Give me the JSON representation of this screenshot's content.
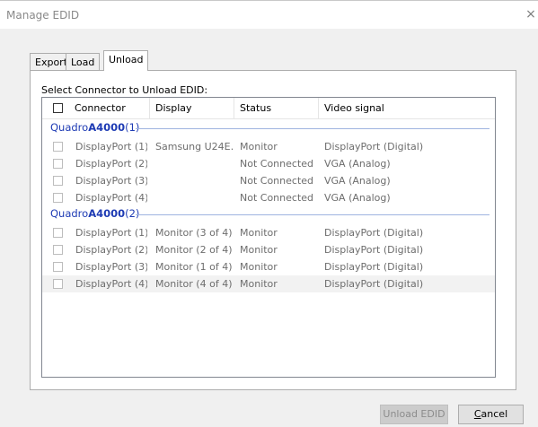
{
  "window": {
    "title": "Manage EDID",
    "close_icon": "×"
  },
  "tabs": [
    {
      "label": "Export",
      "active": false
    },
    {
      "label": "Load",
      "active": false
    },
    {
      "label": "Unload",
      "active": true
    }
  ],
  "panel": {
    "prompt": "Select Connector to Unload EDID:"
  },
  "list": {
    "columns": [
      "Connector",
      "Display",
      "Status",
      "Video signal"
    ],
    "groups": [
      {
        "name": "QuadroA4000",
        "name_prefix": "Quadro",
        "name_bold": "A4000",
        "suffix": "(1)",
        "rows": [
          {
            "connector": "DisplayPort (1)",
            "display": "Samsung U24E…",
            "status": "Monitor",
            "signal": "DisplayPort (Digital)"
          },
          {
            "connector": "DisplayPort (2)",
            "display": "",
            "status": "Not Connected",
            "signal": "VGA (Analog)"
          },
          {
            "connector": "DisplayPort (3)",
            "display": "",
            "status": "Not Connected",
            "signal": "VGA (Analog)"
          },
          {
            "connector": "DisplayPort (4)",
            "display": "",
            "status": "Not Connected",
            "signal": "VGA (Analog)"
          }
        ]
      },
      {
        "name": "QuadroA4000",
        "name_prefix": "Quadro",
        "name_bold": "A4000",
        "suffix": "(2)",
        "rows": [
          {
            "connector": "DisplayPort (1)",
            "display": "Monitor (3 of 4)",
            "status": "Monitor",
            "signal": "DisplayPort (Digital)"
          },
          {
            "connector": "DisplayPort (2)",
            "display": "Monitor (2 of 4)",
            "status": "Monitor",
            "signal": "DisplayPort (Digital)"
          },
          {
            "connector": "DisplayPort (3)",
            "display": "Monitor (1 of 4)",
            "status": "Monitor",
            "signal": "DisplayPort (Digital)"
          },
          {
            "connector": "DisplayPort (4)",
            "display": "Monitor (4 of 4)",
            "status": "Monitor",
            "signal": "DisplayPort (Digital)"
          }
        ]
      }
    ]
  },
  "buttons": {
    "unload": "Unload EDID",
    "cancel_first": "C",
    "cancel_rest": "ancel"
  },
  "colors": {
    "group_text": "#1e3bb4",
    "group_line": "#9fb4e0"
  }
}
